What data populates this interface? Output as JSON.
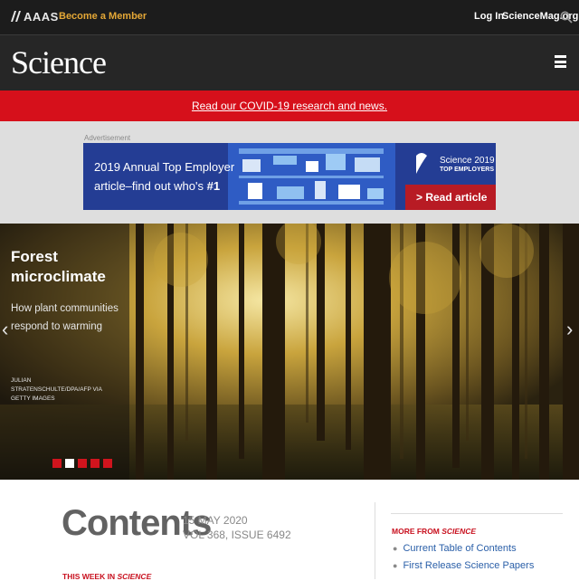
{
  "topbar": {
    "org": "AAAS",
    "member_link": "Become a Member",
    "login": "Log In",
    "site": "ScienceMag.org"
  },
  "header": {
    "logo": "Science"
  },
  "alert": {
    "text": "Read our COVID-19 research and news."
  },
  "ad": {
    "label": "Advertisement",
    "line1": "2019 Annual Top Employer",
    "line2_prefix": "article–find out who's ",
    "line2_bold": "#1",
    "logo_line1": "Science 2019",
    "logo_line2": "TOP EMPLOYERS",
    "cta": "> Read article"
  },
  "hero": {
    "title": "Forest microclimate",
    "subtitle": "How plant communities respond to warming",
    "credit": "JULIAN STRATENSCHULTE/DPA/AFP VIA GETTY IMAGES",
    "slides": 5,
    "active_slide": 2
  },
  "contents": {
    "heading": "Contents",
    "date": "15 MAY 2020",
    "volume": "VOL 368, ISSUE 6492",
    "this_week_prefix": "THIS WEEK IN ",
    "this_week_em": "SCIENCE"
  },
  "more_from": {
    "heading_prefix": "MORE FROM ",
    "heading_em": "SCIENCE",
    "links": [
      "Current Table of Contents",
      "First Release Science Papers"
    ]
  },
  "colors": {
    "topbar_bg": "#1c1c1c",
    "header_bg": "#262626",
    "alert_red": "#d6101b",
    "member_gold": "#e4a736",
    "ad_blue": "#243d94",
    "link_blue": "#2a5fa8"
  },
  "icons": [
    "aaas-logo-icon",
    "search-icon",
    "menu-icon",
    "chevron-left-icon",
    "chevron-right-icon"
  ]
}
